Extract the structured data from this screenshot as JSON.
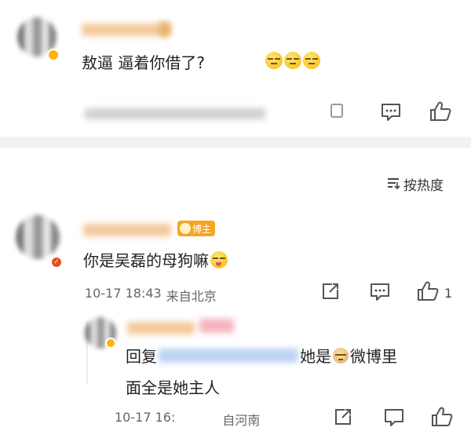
{
  "comment1": {
    "text": "敖逼 逼着你借了?",
    "emojis": [
      "unamused-emoji",
      "unamused-emoji",
      "unamused-emoji"
    ]
  },
  "sort": {
    "label": "按热度",
    "icon": "sort-icon"
  },
  "comment2": {
    "badge": "博主",
    "text": "你是吴磊的母狗嘛",
    "time": "10-17 18:43",
    "location": "来自北京",
    "like_count": "1"
  },
  "reply": {
    "prefix": "回复",
    "text_a": "她是",
    "text_b": "微博里",
    "line2": "面全是她主人",
    "time": "10-17 16:",
    "location": "自河南"
  },
  "colors": {
    "accent": "#ff8200",
    "verified_orange": "#ff8a00",
    "verified_red": "#e64a19",
    "badge_bg": "#f5a623"
  }
}
